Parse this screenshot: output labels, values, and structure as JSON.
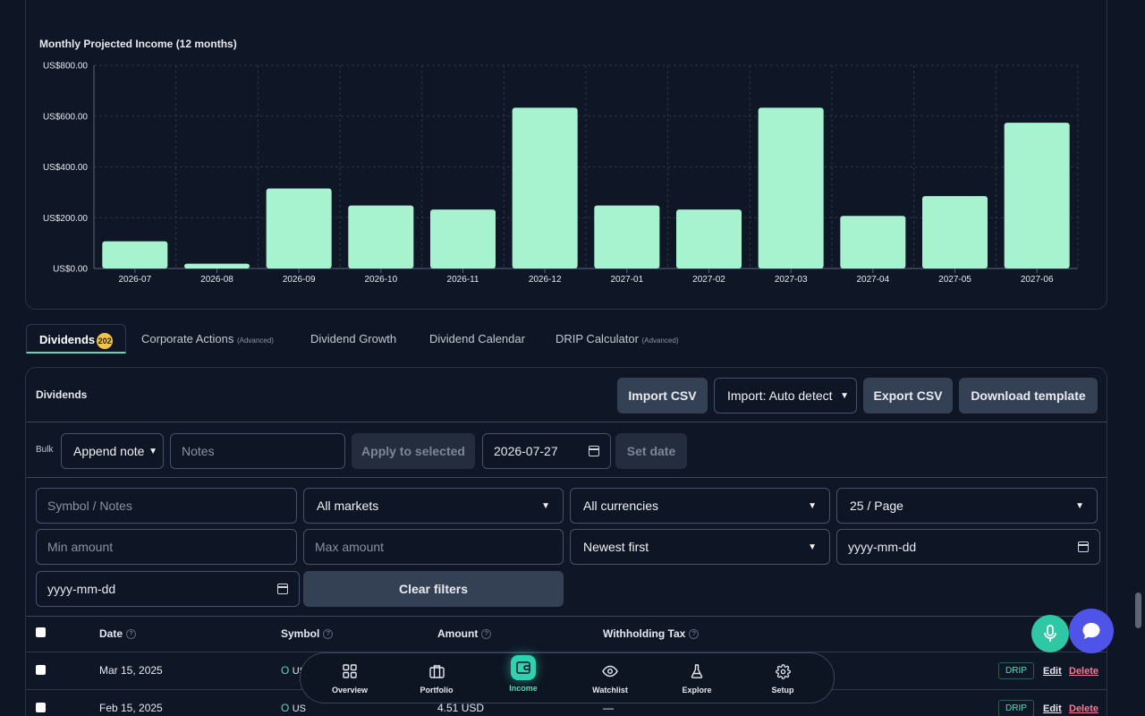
{
  "chart_data": {
    "type": "bar",
    "title": "Monthly Projected Income (12 months)",
    "categories": [
      "2026-07",
      "2026-08",
      "2026-09",
      "2026-10",
      "2026-11",
      "2026-12",
      "2027-01",
      "2027-02",
      "2027-03",
      "2027-04",
      "2027-05",
      "2027-06"
    ],
    "values": [
      107,
      19,
      315,
      248,
      232,
      633,
      248,
      232,
      633,
      207,
      285,
      574
    ],
    "ylim": [
      0,
      800
    ],
    "yticks": [
      "US$0.00",
      "US$200.00",
      "US$400.00",
      "US$600.00",
      "US$800.00"
    ],
    "grid": true,
    "bar_color": "#a7f3d0"
  },
  "tabs": [
    {
      "label": "Dividends",
      "badge": "202"
    },
    {
      "label": "Corporate Actions",
      "tag": "(Advanced)"
    },
    {
      "label": "Dividend Growth"
    },
    {
      "label": "Dividend Calendar"
    },
    {
      "label": "DRIP Calculator",
      "tag": "(Advanced)"
    }
  ],
  "card": {
    "title": "Dividends",
    "import_csv": "Import CSV",
    "import_mode": "Import: Auto detect",
    "export_csv": "Export CSV",
    "download_template": "Download template"
  },
  "bulk": {
    "label": "Bulk",
    "action": "Append note",
    "notes_placeholder": "Notes",
    "apply": "Apply to selected",
    "date": "2026-07-27",
    "set_date": "Set date"
  },
  "filters": {
    "symbol_placeholder": "Symbol / Notes",
    "markets": "All markets",
    "currencies": "All currencies",
    "page_size": "25 / Page",
    "min_placeholder": "Min amount",
    "max_placeholder": "Max amount",
    "sort": "Newest first",
    "date_from_placeholder": "yyyy-mm-dd",
    "date_to_placeholder": "yyyy-mm-dd",
    "clear": "Clear filters"
  },
  "table": {
    "headers": {
      "date": "Date",
      "symbol": "Symbol",
      "amount": "Amount",
      "tax": "Withholding Tax"
    },
    "rows": [
      {
        "date": "Mar 15, 2025",
        "symbol": "O",
        "market": "US",
        "amount": "",
        "tax": ""
      },
      {
        "date": "Feb 15, 2025",
        "symbol": "O",
        "market": "US",
        "amount": "4.51 USD",
        "tax": "—"
      }
    ],
    "drip": "DRIP",
    "edit": "Edit",
    "delete": "Delete"
  },
  "nav": [
    {
      "label": "Overview",
      "icon": "grid-icon"
    },
    {
      "label": "Portfolio",
      "icon": "briefcase-icon"
    },
    {
      "label": "Income",
      "icon": "wallet-icon"
    },
    {
      "label": "Watchlist",
      "icon": "eye-icon"
    },
    {
      "label": "Explore",
      "icon": "flask-icon"
    },
    {
      "label": "Setup",
      "icon": "gear-icon"
    }
  ]
}
